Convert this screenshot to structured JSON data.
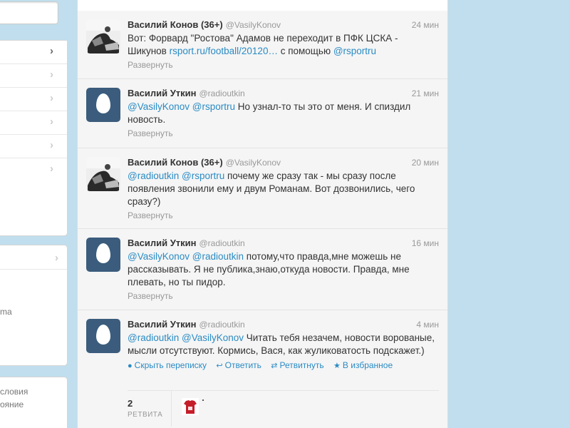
{
  "sidebar": {
    "trend_fragment": "ma",
    "footer_links": [
      "словия",
      "ояние"
    ]
  },
  "tweets": [
    {
      "fullname": "Василий Конов (36+)",
      "username": "@VasilyKonov",
      "time": "24 мин",
      "avatar": "photo",
      "text_parts": [
        {
          "t": "Вот: Форвард \"Ростова\" Адамов не переходит в ПФК ЦСКА - Шикунов ",
          "link": false
        },
        {
          "t": "rsport.ru/football/20120…",
          "link": true
        },
        {
          "t": " с помощью ",
          "link": false
        },
        {
          "t": "@rsportru",
          "link": true
        }
      ],
      "expand": "Развернуть"
    },
    {
      "fullname": "Василий Уткин",
      "username": "@radioutkin",
      "time": "21 мин",
      "avatar": "egg",
      "text_parts": [
        {
          "t": "@VasilyKonov",
          "link": true
        },
        {
          "t": " ",
          "link": false
        },
        {
          "t": "@rsportru",
          "link": true
        },
        {
          "t": " Но узнал-то ты это от меня. И спиздил новость.",
          "link": false
        }
      ],
      "expand": "Развернуть"
    },
    {
      "fullname": "Василий Конов (36+)",
      "username": "@VasilyKonov",
      "time": "20 мин",
      "avatar": "photo",
      "text_parts": [
        {
          "t": "@radioutkin",
          "link": true
        },
        {
          "t": " ",
          "link": false
        },
        {
          "t": "@rsportru",
          "link": true
        },
        {
          "t": " почему же сразу так - мы сразу после появления звонили ему и двум Романам. Вот дозвонились, чего сразу?)",
          "link": false
        }
      ],
      "expand": "Развернуть"
    },
    {
      "fullname": "Василий Уткин",
      "username": "@radioutkin",
      "time": "16 мин",
      "avatar": "egg",
      "text_parts": [
        {
          "t": "@VasilyKonov",
          "link": true
        },
        {
          "t": " ",
          "link": false
        },
        {
          "t": "@radioutkin",
          "link": true
        },
        {
          "t": " потому,что правда,мне можешь не рассказывать. Я не публика,знаю,откуда новости. Правда, мне плевать, но ты пидор.",
          "link": false
        }
      ],
      "expand": "Развернуть"
    },
    {
      "fullname": "Василий Уткин",
      "username": "@radioutkin",
      "time": "4 мин",
      "avatar": "egg",
      "text_parts": [
        {
          "t": "@radioutkin",
          "link": true
        },
        {
          "t": " ",
          "link": false
        },
        {
          "t": "@VasilyKonov",
          "link": true
        },
        {
          "t": " Читать тебя незачем, новости ворованые, мысли отсутствуют. Кормись, Вася, как жуликоватость подскажет.)",
          "link": false
        }
      ],
      "actions": {
        "conversation": "Скрыть переписку",
        "reply": "Ответить",
        "retweet": "Ретвитнуть",
        "favorite": "В избранное"
      },
      "stats": {
        "retweets": "2",
        "retweets_label": "РЕТВИТА"
      }
    }
  ]
}
